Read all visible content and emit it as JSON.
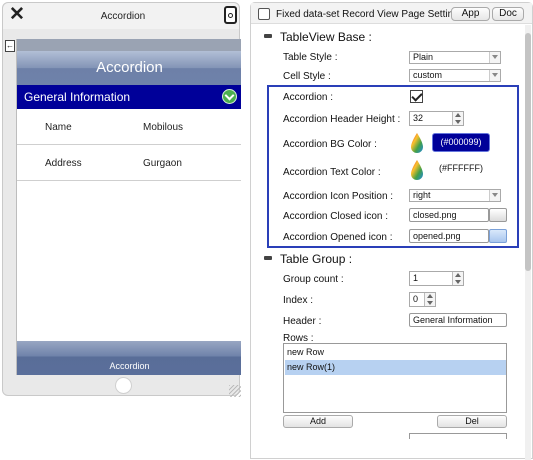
{
  "preview": {
    "title": "Accordion",
    "nav_title": "Accordion",
    "accordion_header": "General Information",
    "rows": [
      {
        "key": "Name",
        "value": "Mobilous"
      },
      {
        "key": "Address",
        "value": "Gurgaon"
      }
    ],
    "tab_label": "Accordion",
    "side_tab_icon": "collapse-icon"
  },
  "panel": {
    "header_title": "Fixed data-set Record View Page Setting",
    "header_checked": false,
    "app_button": "App",
    "doc_button": "Doc",
    "tableview_base": {
      "title": "TableView Base :",
      "table_style_label": "Table Style :",
      "table_style_value": "Plain",
      "cell_style_label": "Cell Style :",
      "cell_style_value": "custom"
    },
    "accordion": {
      "accordion_label": "Accordion :",
      "accordion_checked": true,
      "header_height_label": "Accordion Header Height :",
      "header_height_value": "32",
      "bg_color_label": "Accordion BG Color :",
      "bg_color_value": "(#000099)",
      "bg_color_hex": "#000099",
      "text_color_label": "Accordion Text Color :",
      "text_color_value": "(#FFFFFF)",
      "text_color_hex": "#FFFFFF",
      "icon_position_label": "Accordion Icon Position :",
      "icon_position_value": "right",
      "closed_icon_label": "Accordion Closed icon :",
      "closed_icon_value": "closed.png",
      "opened_icon_label": "Accordion Opened icon :",
      "opened_icon_value": "opened.png"
    },
    "table_group": {
      "title": "Table Group :",
      "group_count_label": "Group count :",
      "group_count_value": "1",
      "index_label": "Index :",
      "index_value": "0",
      "header_label": "Header :",
      "header_value": "General Information",
      "rows_label": "Rows :",
      "rows": [
        "new Row",
        "new Row(1)"
      ],
      "selected_row": "new Row(1)",
      "add_button": "Add",
      "del_button": "Del"
    }
  },
  "colors": {
    "accent_box": "#2a3fb8",
    "accordion_bg": "#000099",
    "nav_bar": "#7a8cb0",
    "selection": "#b7d1f1"
  }
}
